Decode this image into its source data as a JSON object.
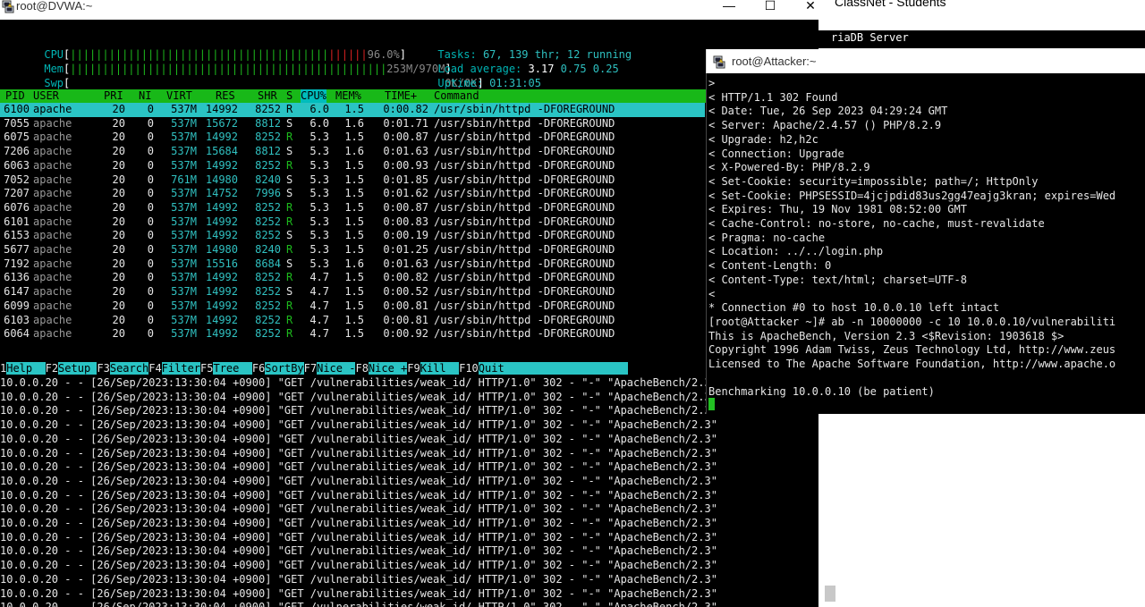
{
  "bg_window": {
    "title": "ClassNet - Students",
    "terminal_line": "riaDB Server"
  },
  "dvwa": {
    "title": "root@DVWA:~",
    "controls": {
      "minimize": "—",
      "maximize": "☐",
      "close": "✕"
    },
    "htop": {
      "cpu_label": "CPU",
      "cpu_value": "96.0%",
      "mem_label": "Mem",
      "mem_value": "253M/970M",
      "swp_label": "Swp",
      "swp_value": "0K/0K",
      "tasks_label": "Tasks:",
      "tasks_value": "67, 139 thr; 12 running",
      "load_label": "Load average:",
      "load_values": [
        "3.17",
        "0.75",
        "0.25"
      ],
      "uptime_label": "Uptime:",
      "uptime_value": "01:31:05",
      "cpu_usage_fraction": 0.96,
      "mem_usage_fraction": 0.26
    },
    "columns": [
      "PID",
      "USER",
      "PRI",
      "NI",
      "VIRT",
      "RES",
      "SHR",
      "S",
      "CPU%",
      "MEM%",
      "TIME+",
      "Command"
    ],
    "processes": [
      {
        "pid": "6100",
        "user": "apache",
        "pri": "20",
        "ni": "0",
        "virt": "537M",
        "res": "14992",
        "shr": "8252",
        "s": "R",
        "cpu": "6.0",
        "mem": "1.5",
        "time": "0:00.82",
        "cmd": "/usr/sbin/httpd -DFOREGROUND"
      },
      {
        "pid": "7055",
        "user": "apache",
        "pri": "20",
        "ni": "0",
        "virt": "537M",
        "res": "15672",
        "shr": "8812",
        "s": "S",
        "cpu": "6.0",
        "mem": "1.6",
        "time": "0:01.71",
        "cmd": "/usr/sbin/httpd -DFOREGROUND"
      },
      {
        "pid": "6075",
        "user": "apache",
        "pri": "20",
        "ni": "0",
        "virt": "537M",
        "res": "14992",
        "shr": "8252",
        "s": "R",
        "cpu": "5.3",
        "mem": "1.5",
        "time": "0:00.87",
        "cmd": "/usr/sbin/httpd -DFOREGROUND"
      },
      {
        "pid": "7206",
        "user": "apache",
        "pri": "20",
        "ni": "0",
        "virt": "537M",
        "res": "15684",
        "shr": "8812",
        "s": "S",
        "cpu": "5.3",
        "mem": "1.6",
        "time": "0:01.63",
        "cmd": "/usr/sbin/httpd -DFOREGROUND"
      },
      {
        "pid": "6063",
        "user": "apache",
        "pri": "20",
        "ni": "0",
        "virt": "537M",
        "res": "14992",
        "shr": "8252",
        "s": "R",
        "cpu": "5.3",
        "mem": "1.5",
        "time": "0:00.93",
        "cmd": "/usr/sbin/httpd -DFOREGROUND"
      },
      {
        "pid": "7052",
        "user": "apache",
        "pri": "20",
        "ni": "0",
        "virt": "761M",
        "res": "14980",
        "shr": "8240",
        "s": "S",
        "cpu": "5.3",
        "mem": "1.5",
        "time": "0:01.85",
        "cmd": "/usr/sbin/httpd -DFOREGROUND"
      },
      {
        "pid": "7207",
        "user": "apache",
        "pri": "20",
        "ni": "0",
        "virt": "537M",
        "res": "14752",
        "shr": "7996",
        "s": "S",
        "cpu": "5.3",
        "mem": "1.5",
        "time": "0:01.62",
        "cmd": "/usr/sbin/httpd -DFOREGROUND"
      },
      {
        "pid": "6076",
        "user": "apache",
        "pri": "20",
        "ni": "0",
        "virt": "537M",
        "res": "14992",
        "shr": "8252",
        "s": "R",
        "cpu": "5.3",
        "mem": "1.5",
        "time": "0:00.87",
        "cmd": "/usr/sbin/httpd -DFOREGROUND"
      },
      {
        "pid": "6101",
        "user": "apache",
        "pri": "20",
        "ni": "0",
        "virt": "537M",
        "res": "14992",
        "shr": "8252",
        "s": "R",
        "cpu": "5.3",
        "mem": "1.5",
        "time": "0:00.83",
        "cmd": "/usr/sbin/httpd -DFOREGROUND"
      },
      {
        "pid": "6153",
        "user": "apache",
        "pri": "20",
        "ni": "0",
        "virt": "537M",
        "res": "14992",
        "shr": "8252",
        "s": "S",
        "cpu": "5.3",
        "mem": "1.5",
        "time": "0:00.19",
        "cmd": "/usr/sbin/httpd -DFOREGROUND"
      },
      {
        "pid": "5677",
        "user": "apache",
        "pri": "20",
        "ni": "0",
        "virt": "537M",
        "res": "14980",
        "shr": "8240",
        "s": "R",
        "cpu": "5.3",
        "mem": "1.5",
        "time": "0:01.25",
        "cmd": "/usr/sbin/httpd -DFOREGROUND"
      },
      {
        "pid": "7192",
        "user": "apache",
        "pri": "20",
        "ni": "0",
        "virt": "537M",
        "res": "15516",
        "shr": "8684",
        "s": "S",
        "cpu": "5.3",
        "mem": "1.6",
        "time": "0:01.63",
        "cmd": "/usr/sbin/httpd -DFOREGROUND"
      },
      {
        "pid": "6136",
        "user": "apache",
        "pri": "20",
        "ni": "0",
        "virt": "537M",
        "res": "14992",
        "shr": "8252",
        "s": "R",
        "cpu": "4.7",
        "mem": "1.5",
        "time": "0:00.82",
        "cmd": "/usr/sbin/httpd -DFOREGROUND"
      },
      {
        "pid": "6147",
        "user": "apache",
        "pri": "20",
        "ni": "0",
        "virt": "537M",
        "res": "14992",
        "shr": "8252",
        "s": "S",
        "cpu": "4.7",
        "mem": "1.5",
        "time": "0:00.52",
        "cmd": "/usr/sbin/httpd -DFOREGROUND"
      },
      {
        "pid": "6099",
        "user": "apache",
        "pri": "20",
        "ni": "0",
        "virt": "537M",
        "res": "14992",
        "shr": "8252",
        "s": "R",
        "cpu": "4.7",
        "mem": "1.5",
        "time": "0:00.81",
        "cmd": "/usr/sbin/httpd -DFOREGROUND"
      },
      {
        "pid": "6103",
        "user": "apache",
        "pri": "20",
        "ni": "0",
        "virt": "537M",
        "res": "14992",
        "shr": "8252",
        "s": "R",
        "cpu": "4.7",
        "mem": "1.5",
        "time": "0:00.81",
        "cmd": "/usr/sbin/httpd -DFOREGROUND"
      },
      {
        "pid": "6064",
        "user": "apache",
        "pri": "20",
        "ni": "0",
        "virt": "537M",
        "res": "14992",
        "shr": "8252",
        "s": "R",
        "cpu": "4.7",
        "mem": "1.5",
        "time": "0:00.92",
        "cmd": "/usr/sbin/httpd -DFOREGROUND"
      }
    ],
    "fkeys": [
      {
        "key": "1",
        "label": "Help  "
      },
      {
        "key": "F2",
        "label": "Setup "
      },
      {
        "key": "F3",
        "label": "Search"
      },
      {
        "key": "F4",
        "label": "Filter"
      },
      {
        "key": "F5",
        "label": "Tree  "
      },
      {
        "key": "F6",
        "label": "SortBy"
      },
      {
        "key": "F7",
        "label": "Nice -"
      },
      {
        "key": "F8",
        "label": "Nice +"
      },
      {
        "key": "F9",
        "label": "Kill  "
      },
      {
        "key": "F10",
        "label": "Quit"
      }
    ],
    "log_lines": [
      "10.0.0.20 - - [26/Sep/2023:13:30:04 +0900] \"GET /vulnerabilities/weak_id/ HTTP/1.0\" 302 - \"-\" \"ApacheBench/2.3\"",
      "10.0.0.20 - - [26/Sep/2023:13:30:04 +0900] \"GET /vulnerabilities/weak_id/ HTTP/1.0\" 302 - \"-\" \"ApacheBench/2.3\"",
      "10.0.0.20 - - [26/Sep/2023:13:30:04 +0900] \"GET /vulnerabilities/weak_id/ HTTP/1.0\" 302 - \"-\" \"ApacheBench/2.3\"",
      "10.0.0.20 - - [26/Sep/2023:13:30:04 +0900] \"GET /vulnerabilities/weak_id/ HTTP/1.0\" 302 - \"-\" \"ApacheBench/2.3\"",
      "10.0.0.20 - - [26/Sep/2023:13:30:04 +0900] \"GET /vulnerabilities/weak_id/ HTTP/1.0\" 302 - \"-\" \"ApacheBench/2.3\"",
      "10.0.0.20 - - [26/Sep/2023:13:30:04 +0900] \"GET /vulnerabilities/weak_id/ HTTP/1.0\" 302 - \"-\" \"ApacheBench/2.3\"",
      "10.0.0.20 - - [26/Sep/2023:13:30:04 +0900] \"GET /vulnerabilities/weak_id/ HTTP/1.0\" 302 - \"-\" \"ApacheBench/2.3\"",
      "10.0.0.20 - - [26/Sep/2023:13:30:04 +0900] \"GET /vulnerabilities/weak_id/ HTTP/1.0\" 302 - \"-\" \"ApacheBench/2.3\"",
      "10.0.0.20 - - [26/Sep/2023:13:30:04 +0900] \"GET /vulnerabilities/weak_id/ HTTP/1.0\" 302 - \"-\" \"ApacheBench/2.3\"",
      "10.0.0.20 - - [26/Sep/2023:13:30:04 +0900] \"GET /vulnerabilities/weak_id/ HTTP/1.0\" 302 - \"-\" \"ApacheBench/2.3\"",
      "10.0.0.20 - - [26/Sep/2023:13:30:04 +0900] \"GET /vulnerabilities/weak_id/ HTTP/1.0\" 302 - \"-\" \"ApacheBench/2.3\"",
      "10.0.0.20 - - [26/Sep/2023:13:30:04 +0900] \"GET /vulnerabilities/weak_id/ HTTP/1.0\" 302 - \"-\" \"ApacheBench/2.3\"",
      "10.0.0.20 - - [26/Sep/2023:13:30:04 +0900] \"GET /vulnerabilities/weak_id/ HTTP/1.0\" 302 - \"-\" \"ApacheBench/2.3\"",
      "10.0.0.20 - - [26/Sep/2023:13:30:04 +0900] \"GET /vulnerabilities/weak_id/ HTTP/1.0\" 302 - \"-\" \"ApacheBench/2.3\"",
      "10.0.0.20 - - [26/Sep/2023:13:30:04 +0900] \"GET /vulnerabilities/weak_id/ HTTP/1.0\" 302 - \"-\" \"ApacheBench/2.3\"",
      "10.0.0.20 - - [26/Sep/2023:13:30:04 +0900] \"GET /vulnerabilities/weak_id/ HTTP/1.0\" 302 - \"-\" \"ApacheBench/2.3\"",
      "10.0.0.20 - - [26/Sep/2023:13:30:04 +0900] \"GET /vulnerabilities/weak_id/ HTTP/1.0\" 302 - \"-\" \"ApacheBench/2.3\""
    ]
  },
  "attacker": {
    "title": "root@Attacker:~",
    "lines": [
      ">",
      "< HTTP/1.1 302 Found",
      "< Date: Tue, 26 Sep 2023 04:29:24 GMT",
      "< Server: Apache/2.4.57 () PHP/8.2.9",
      "< Upgrade: h2,h2c",
      "< Connection: Upgrade",
      "< X-Powered-By: PHP/8.2.9",
      "< Set-Cookie: security=impossible; path=/; HttpOnly",
      "< Set-Cookie: PHPSESSID=4jcjpdid83us2gg47eajg3kran; expires=Wed",
      "< Expires: Thu, 19 Nov 1981 08:52:00 GMT",
      "< Cache-Control: no-store, no-cache, must-revalidate",
      "< Pragma: no-cache",
      "< Location: ../../login.php",
      "< Content-Length: 0",
      "< Content-Type: text/html; charset=UTF-8",
      "<",
      "* Connection #0 to host 10.0.0.10 left intact",
      "[root@Attacker ~]# ab -n 10000000 -c 10 10.0.0.10/vulnerabiliti",
      "This is ApacheBench, Version 2.3 <$Revision: 1903618 $>",
      "Copyright 1996 Adam Twiss, Zeus Technology Ltd, http://www.zeus",
      "Licensed to The Apache Software Foundation, http://www.apache.o",
      "",
      "Benchmarking 10.0.0.10 (be patient)"
    ]
  }
}
